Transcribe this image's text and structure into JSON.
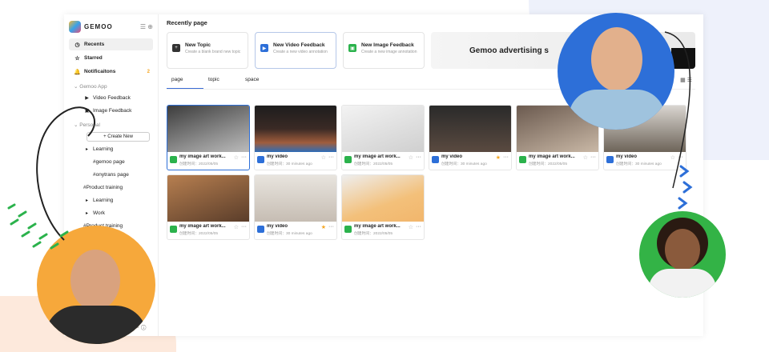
{
  "sidebar": {
    "logo_text": "GEMOO",
    "nav": [
      {
        "label": "Recents",
        "icon": "clock-icon",
        "active": true
      },
      {
        "label": "Starred",
        "icon": "star-icon"
      },
      {
        "label": "Notificaitons",
        "icon": "bell-icon",
        "count": "2"
      }
    ],
    "section_app": "Gemoo App",
    "app_items": [
      {
        "label": "Video Feedback",
        "icon": "video-icon"
      },
      {
        "label": "Image Feedback",
        "icon": "image-icon"
      }
    ],
    "section_personal": "Personal",
    "create_new": "+ Create New",
    "personal_items": [
      {
        "label": "Learning",
        "level": "sub"
      },
      {
        "label": "#gemoo page",
        "level": "deep"
      },
      {
        "label": "#onytrans page",
        "level": "deep"
      },
      {
        "label": "#Product training",
        "level": "flat"
      },
      {
        "label": "Learning",
        "level": "sub"
      },
      {
        "label": "Work",
        "level": "sub"
      },
      {
        "label": "#Product training",
        "level": "flat"
      }
    ]
  },
  "main": {
    "title": "Recently page",
    "create_cards": [
      {
        "title": "New Topic",
        "desc": "Create a blank brand new topic",
        "color": "#333333",
        "icon": "plus-icon"
      },
      {
        "title": "New Video Feedback",
        "desc": "Create a new video annotation",
        "color": "#2d6fd8",
        "icon": "video-icon"
      },
      {
        "title": "New Image Feedback",
        "desc": "Create a new image annotation",
        "color": "#2bb24c",
        "icon": "image-icon"
      }
    ],
    "ad_text": "Gemoo advertising s",
    "tabs": [
      "page",
      "topic",
      "space"
    ],
    "files": [
      {
        "name": "my image art work...",
        "date": "创建时间：2022/05/05",
        "type": "img",
        "starred": false,
        "thumb": "t1",
        "selected": true
      },
      {
        "name": "my video",
        "date": "创建时间：30 minutes ago",
        "type": "vid",
        "starred": false,
        "thumb": "t2"
      },
      {
        "name": "my image art work...",
        "date": "创建时间：2022/05/05",
        "type": "img",
        "starred": false,
        "thumb": "t3"
      },
      {
        "name": "my video",
        "date": "创建时间：30 minutes ago",
        "type": "vid",
        "starred": true,
        "thumb": "t4"
      },
      {
        "name": "my image art work...",
        "date": "创建时间：2022/05/05",
        "type": "img",
        "starred": false,
        "thumb": "t5"
      },
      {
        "name": "my video",
        "date": "创建时间：30 minutes ago",
        "type": "vid",
        "starred": false,
        "thumb": "t6"
      },
      {
        "name": "my image art work...",
        "date": "创建时间：2022/05/05",
        "type": "img",
        "starred": false,
        "thumb": "t7"
      },
      {
        "name": "my video",
        "date": "创建时间：30 minutes ago",
        "type": "vid",
        "starred": true,
        "thumb": "t8"
      },
      {
        "name": "my image art work...",
        "date": "创建时间：2022/05/05",
        "type": "img",
        "starred": false,
        "thumb": "t9"
      }
    ]
  },
  "colors": {
    "accent": "#2d6fd8",
    "green": "#2bb24c",
    "star": "#f5a623"
  }
}
